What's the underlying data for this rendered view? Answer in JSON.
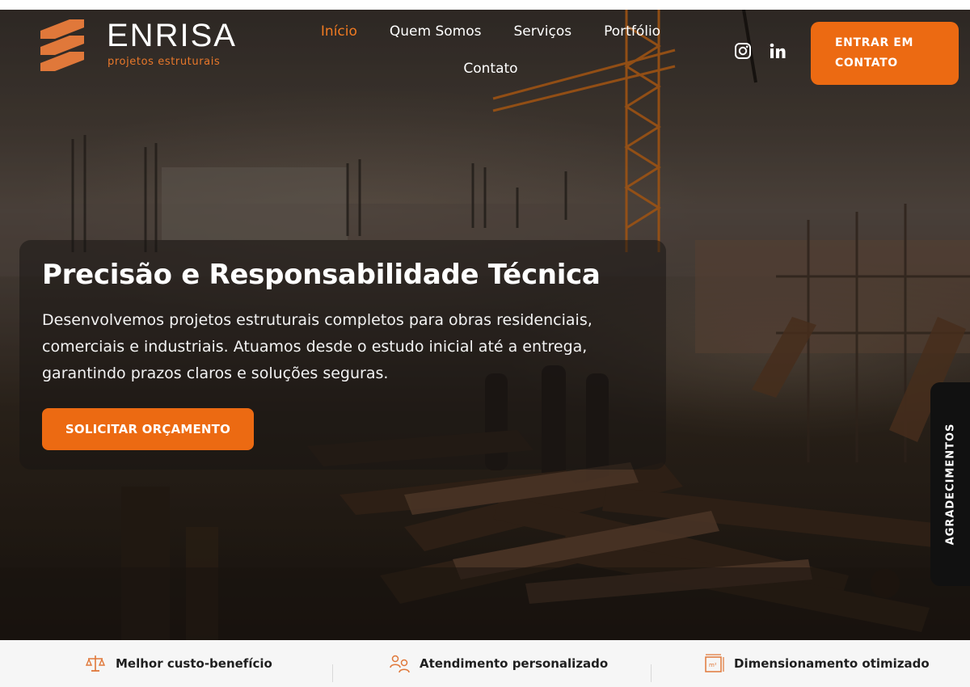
{
  "brand": {
    "name": "ENRISA",
    "tagline": "projetos estruturais",
    "accent_color": "#ec6a12"
  },
  "nav": {
    "items": [
      {
        "label": "Início",
        "active": true
      },
      {
        "label": "Quem Somos",
        "active": false
      },
      {
        "label": "Serviços",
        "active": false
      },
      {
        "label": "Portfólio",
        "active": false
      },
      {
        "label": "Contato",
        "active": false
      }
    ]
  },
  "social": [
    {
      "icon": "instagram-icon"
    },
    {
      "icon": "linkedin-icon"
    }
  ],
  "header_cta": {
    "label_line1": "ENTRAR EM",
    "label_line2": "CONTATO"
  },
  "hero": {
    "title": "Precisão e Responsabilidade Técnica",
    "text": "Desenvolvemos projetos estruturais completos para obras residenciais, comerciais e industriais. Atuamos desde o estudo inicial até a entrega, garantindo prazos claros e soluções seguras.",
    "button_label": "SOLICITAR ORÇAMENTO",
    "background": "construction-site-photo"
  },
  "side_tab": {
    "label": "AGRADECIMENTOS"
  },
  "features": [
    {
      "icon": "scale-icon",
      "label": "Melhor custo-benefício"
    },
    {
      "icon": "support-people-icon",
      "label": "Atendimento personalizado"
    },
    {
      "icon": "square-meter-icon",
      "label": "Dimensionamento otimizado"
    }
  ]
}
